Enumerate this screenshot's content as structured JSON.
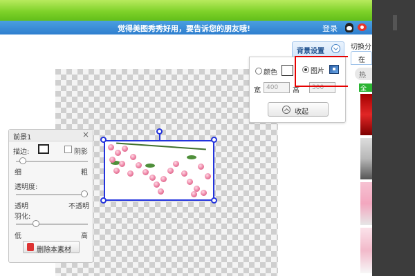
{
  "header": {
    "message": "觉得美图秀秀好用，要告诉您的朋友哦!",
    "login": "登录"
  },
  "foreground_panel": {
    "title": "前景1",
    "close": "×",
    "border_label": "描边:",
    "shadow_label": "阴影",
    "thin_label": "细",
    "thick_label": "粗",
    "opacity_label": "透明度:",
    "transparent_label": "透明",
    "opaque_label": "不透明",
    "feather_label": "羽化:",
    "low_label": "低",
    "high_label": "高",
    "delete_button": "删除本素材",
    "border_level": 0.05,
    "opacity_level": 1.0,
    "feather_level": 0.25
  },
  "background_settings": {
    "tab_label": "背景设置",
    "color_option": "颜色",
    "image_option": "图片",
    "selected_option": "图片",
    "width_label": "宽",
    "width_value": "400",
    "height_label": "高",
    "height_value": "300",
    "collapse_button": "收起"
  },
  "right_panel": {
    "header": "切换分",
    "tab": "在",
    "pill": "热",
    "category": "全部"
  },
  "colors": {
    "accent_blue": "#2f7fcf",
    "highlight_red": "#e60000",
    "selection_blue": "#2233dd"
  }
}
